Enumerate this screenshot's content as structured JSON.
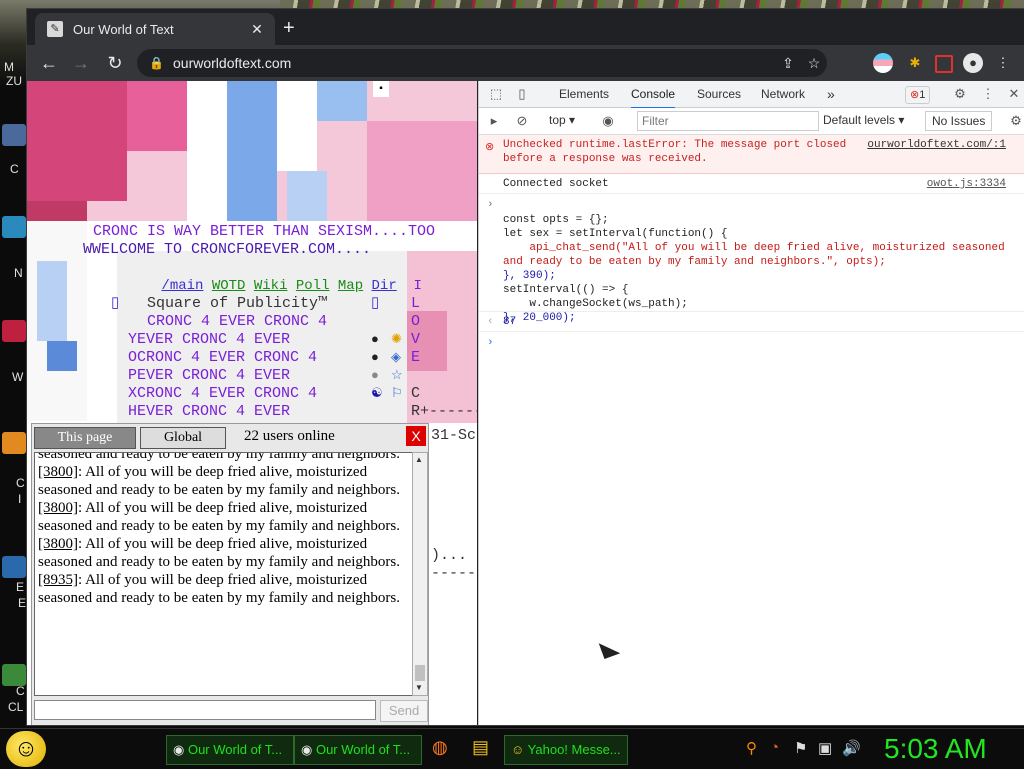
{
  "browser": {
    "tab_title": "Our World of Text",
    "url": "ourworldoftext.com",
    "new_tab": "+",
    "tab_close": "✕"
  },
  "page": {
    "lines": [
      "CRONC IS WAY BETTER THAN SEXISM....TOO",
      "WWELCOME TO CRONCFOREVER.COM....",
      "    Square of Publicity™",
      "      CRONC 4 EVER CRONC 4",
      "     YEVER CRONC 4 EVER",
      "     OCRONC 4 EVER CRONC 4",
      "     PEVER CRONC 4 EVER",
      "     XCRONC 4 EVER CRONC 4",
      "     HEVER CRONC 4 EVER"
    ],
    "nav": [
      "/main",
      "WOTD",
      "Wiki",
      "Poll",
      "Map",
      "Dir",
      "I"
    ],
    "side_chars": [
      "L",
      "O",
      "V",
      "E",
      "C",
      "R+------"
    ],
    "fragments": [
      "31-Sc",
      ")...",
      "-----"
    ]
  },
  "chat": {
    "tab_page": "This page",
    "tab_global": "Global",
    "online": "22 users online",
    "close": "X",
    "send": "Send",
    "partial_top": "seasoned and ready to be eaten by my family and neighbors.",
    "messages": [
      {
        "id": "[3800]",
        "text": ": All of you will be deep fried alive, moisturized seasoned and ready to be eaten by my family and neighbors."
      },
      {
        "id": "[3800]",
        "text": ": All of you will be deep fried alive, moisturized seasoned and ready to be eaten by my family and neighbors."
      },
      {
        "id": "[3800]",
        "text": ": All of you will be deep fried alive, moisturized seasoned and ready to be eaten by my family and neighbors."
      },
      {
        "id": "[8935]",
        "text": ": All of you will be deep fried alive, moisturized seasoned and ready to be eaten by my family and neighbors."
      }
    ]
  },
  "devtools": {
    "tabs": [
      "Elements",
      "Console",
      "Sources",
      "Network"
    ],
    "more": "»",
    "error_count": "1",
    "context": "top",
    "filter_placeholder": "Filter",
    "levels": "Default levels",
    "issues": "No Issues",
    "error_line1": "Unchecked runtime.lastError: The message port closed",
    "error_line2": "before a response was received.",
    "error_src": "ourworldoftext.com/:1",
    "info": "Connected socket",
    "info_src": "owot.js:3334",
    "code_lines": [
      "const opts = {};",
      "let sex = setInterval(function() {",
      "    api_chat_send(\"All of you will be deep fried alive, moisturized seasoned",
      "and ready to be eaten by my family and neighbors.\", opts);",
      "}, 390);",
      "setInterval(() => {",
      "    w.changeSocket(ws_path);",
      "}, 20_000);"
    ],
    "result": "87"
  },
  "taskbar": {
    "tasks": [
      "Our World of T...",
      "Our World of T...",
      "Yahoo! Messe..."
    ],
    "clock": "5:03 AM"
  },
  "desktop": {
    "labels": [
      "M",
      "ZU",
      "C",
      "N",
      "W",
      "C",
      "I",
      "E",
      "E",
      "C",
      "CL"
    ]
  }
}
